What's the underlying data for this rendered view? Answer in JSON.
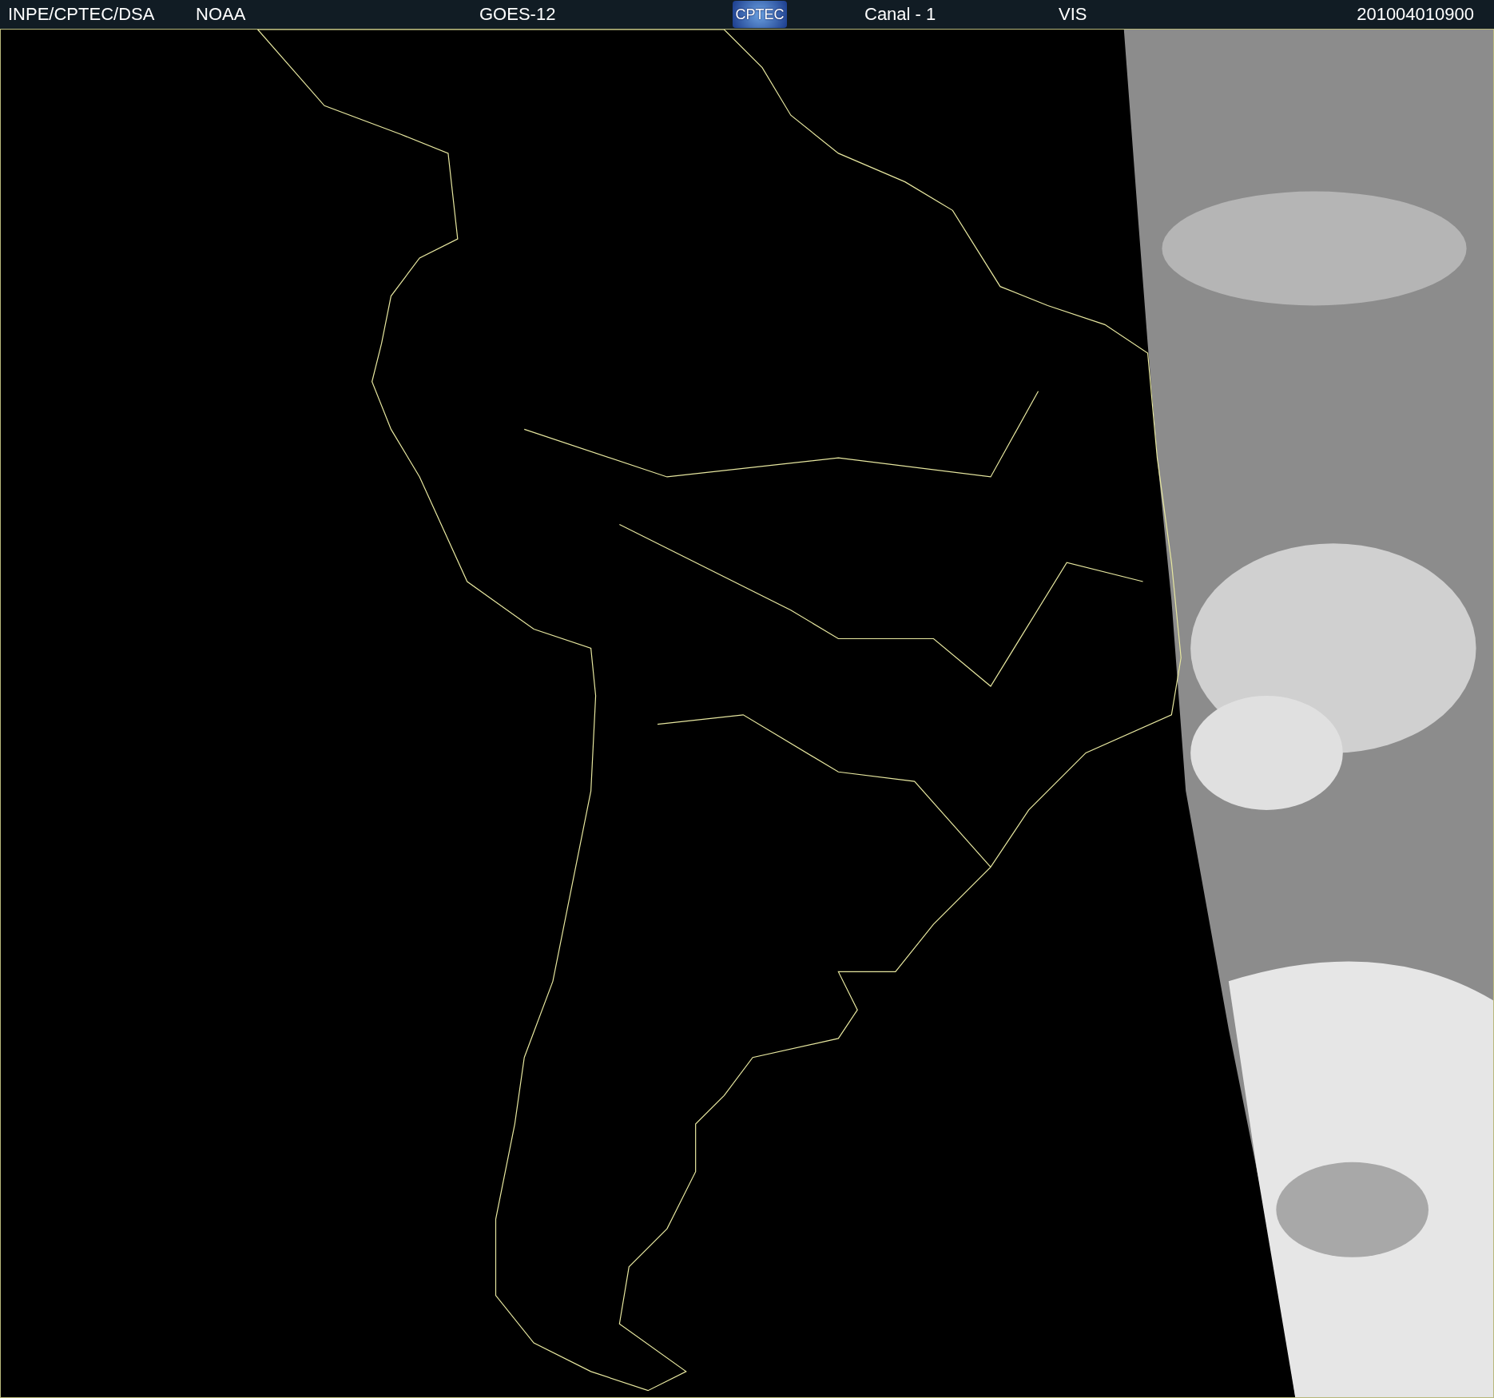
{
  "header": {
    "source": "INPE/CPTEC/DSA",
    "agency": "NOAA",
    "satellite": "GOES-12",
    "logo": "CPTEC",
    "channel": "Canal - 1",
    "band": "VIS",
    "timestamp": "201004010900"
  }
}
